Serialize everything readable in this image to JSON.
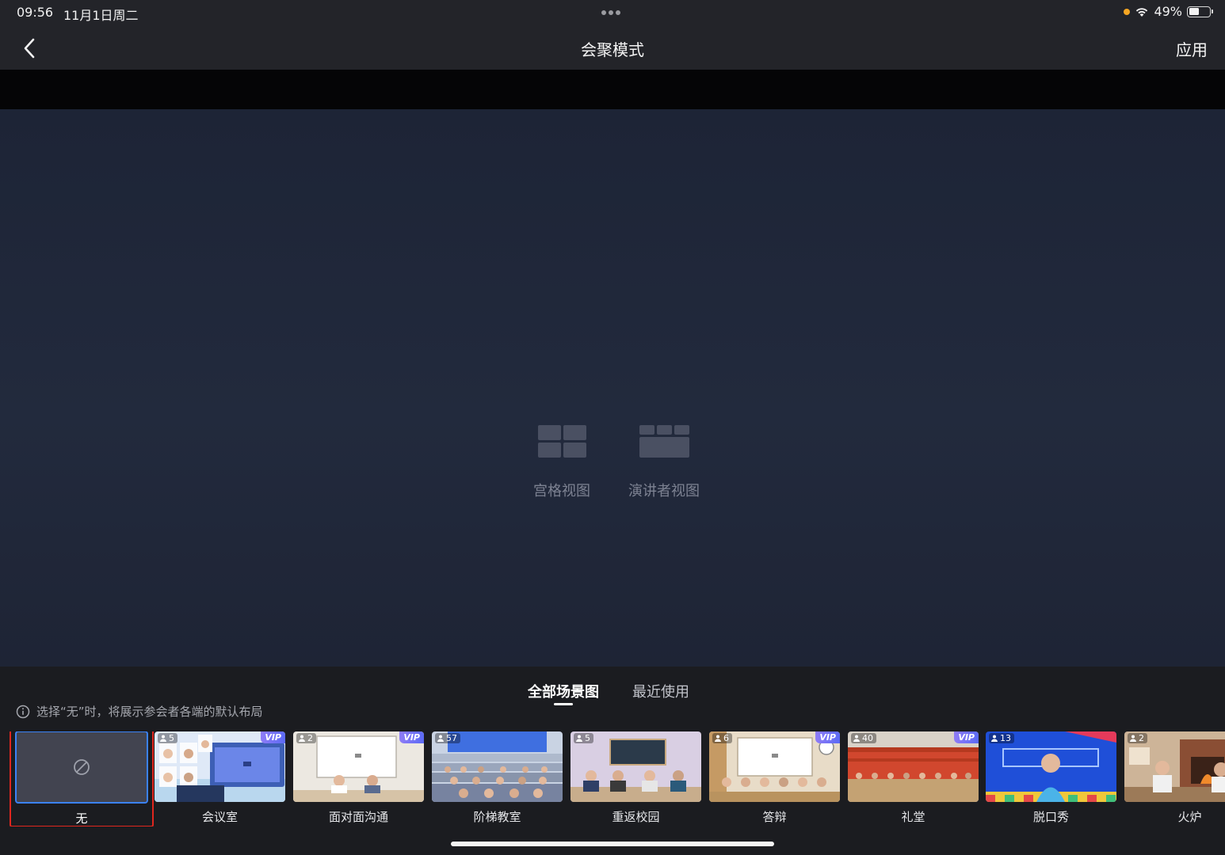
{
  "status_bar": {
    "time": "09:56",
    "date": "11月1日周二",
    "battery": "49%",
    "battery_level": 0.49
  },
  "nav": {
    "title": "会聚模式",
    "apply_label": "应用"
  },
  "preview": {
    "grid_view_label": "宫格视图",
    "speaker_view_label": "演讲者视图"
  },
  "tabs": {
    "all_label": "全部场景图",
    "recent_label": "最近使用"
  },
  "hint": "选择“无”时，将展示参会者各端的默认布局",
  "scenes": {
    "none": {
      "name": "无"
    },
    "items": [
      {
        "name": "会议室",
        "count": "5",
        "vip": "VIP"
      },
      {
        "name": "面对面沟通",
        "count": "2",
        "vip": "VIP"
      },
      {
        "name": "阶梯教室",
        "count": "57"
      },
      {
        "name": "重返校园",
        "count": "5"
      },
      {
        "name": "答辩",
        "count": "6",
        "vip": "VIP"
      },
      {
        "name": "礼堂",
        "count": "40",
        "vip": "VIP"
      },
      {
        "name": "脱口秀",
        "count": "13"
      },
      {
        "name": "火炉",
        "count": "2"
      }
    ]
  },
  "colors": {
    "accent_selected": "#3b82f6",
    "highlight_border": "#e0261e",
    "vip_gradient_start": "#8f7cf6",
    "status_dot": "#f5a623"
  }
}
